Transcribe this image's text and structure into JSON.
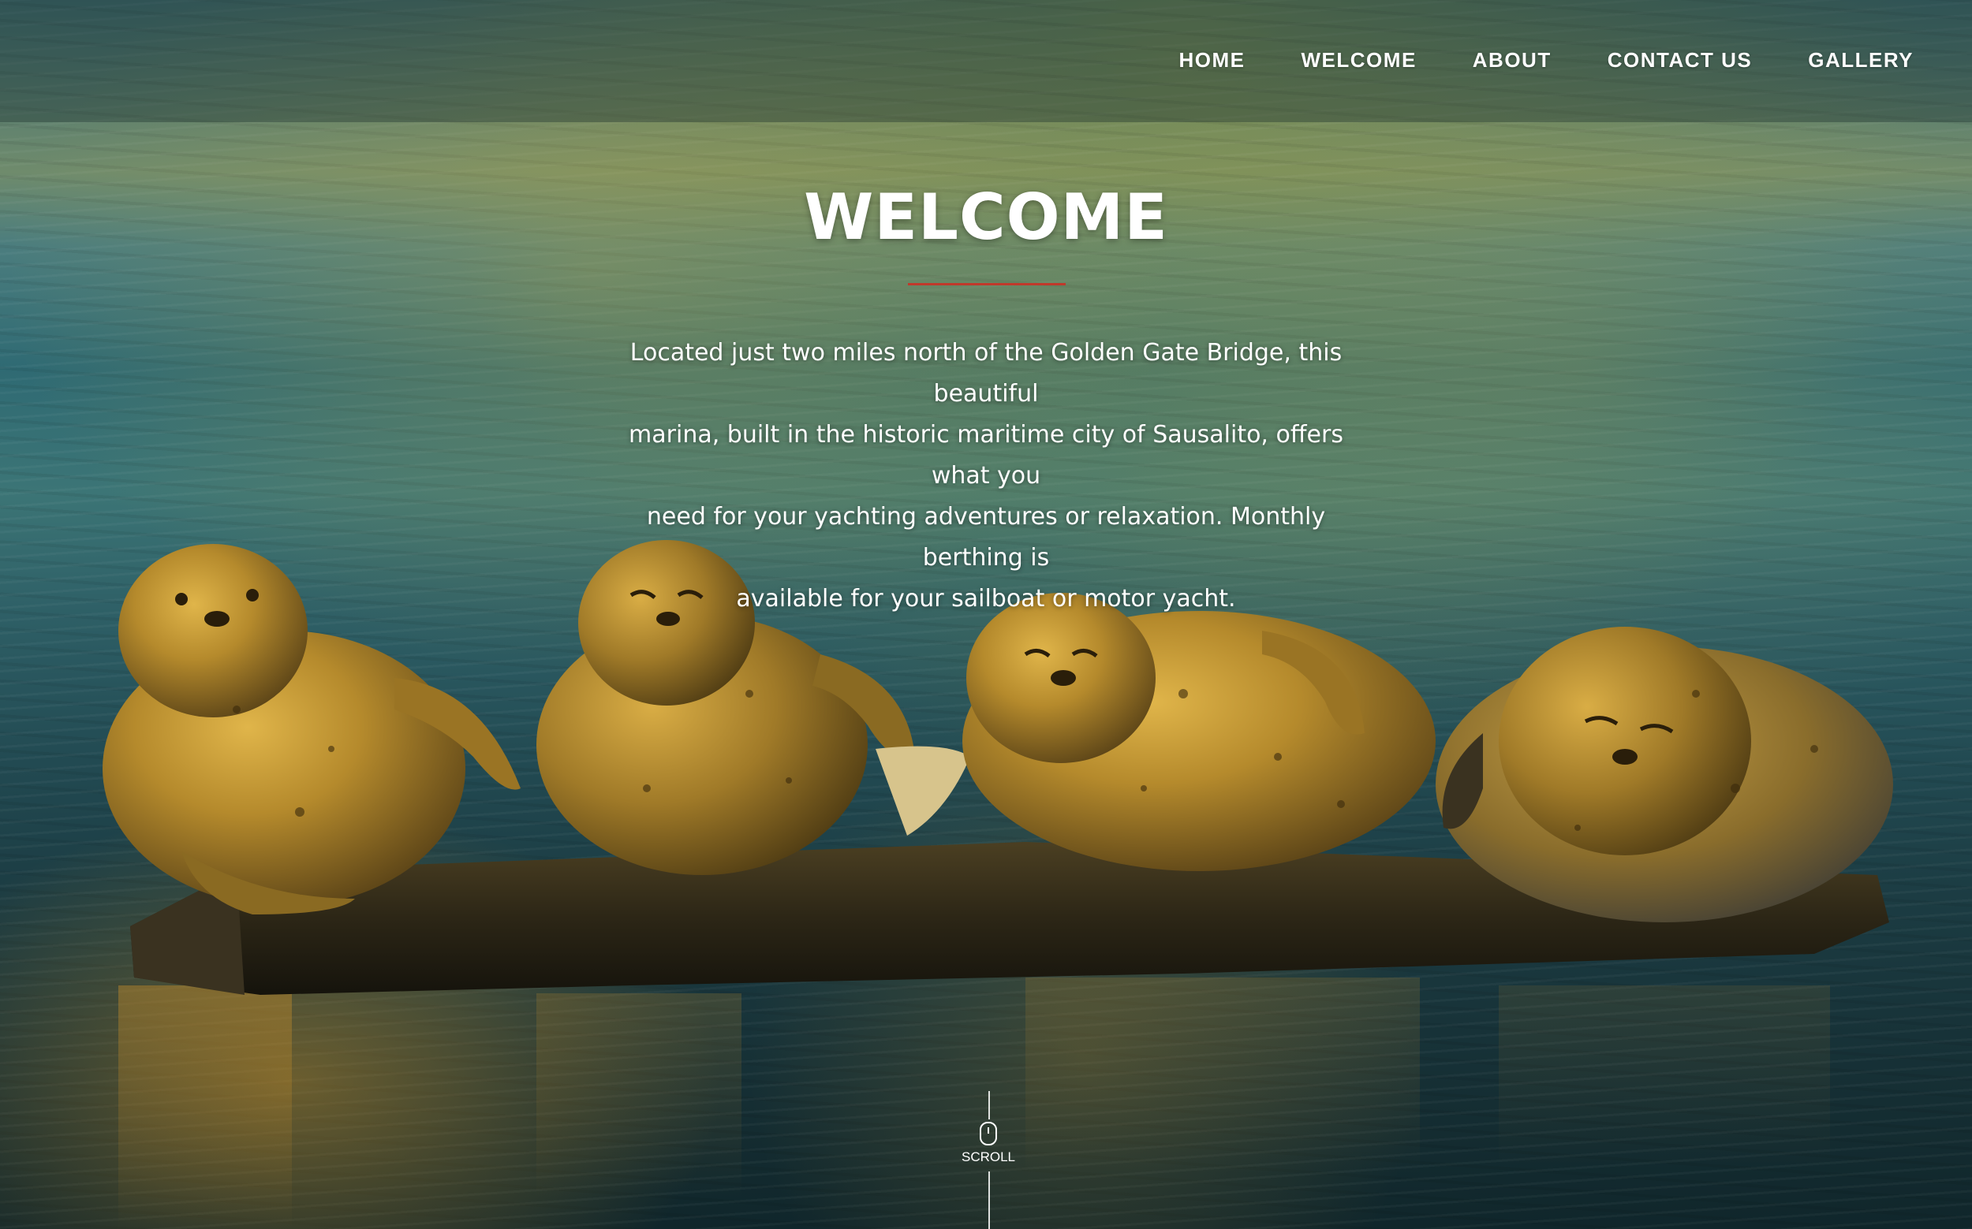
{
  "nav": {
    "items": [
      {
        "label": "HOME"
      },
      {
        "label": "WELCOME"
      },
      {
        "label": "ABOUT"
      },
      {
        "label": "CONTACT US"
      },
      {
        "label": "GALLERY"
      }
    ]
  },
  "hero": {
    "title": "WELCOME",
    "intro_line1": "Located just two miles north of the Golden Gate Bridge, this beautiful",
    "intro_line2": "marina, built in the historic maritime city of Sausalito, offers what you",
    "intro_line3": "need for your yachting adventures or relaxation.  Monthly berthing is",
    "intro_line4": "available for your sailboat or motor yacht.",
    "accent_color": "#c0392b"
  },
  "scroll": {
    "label": "SCROLL",
    "icon": "mouse-icon"
  }
}
